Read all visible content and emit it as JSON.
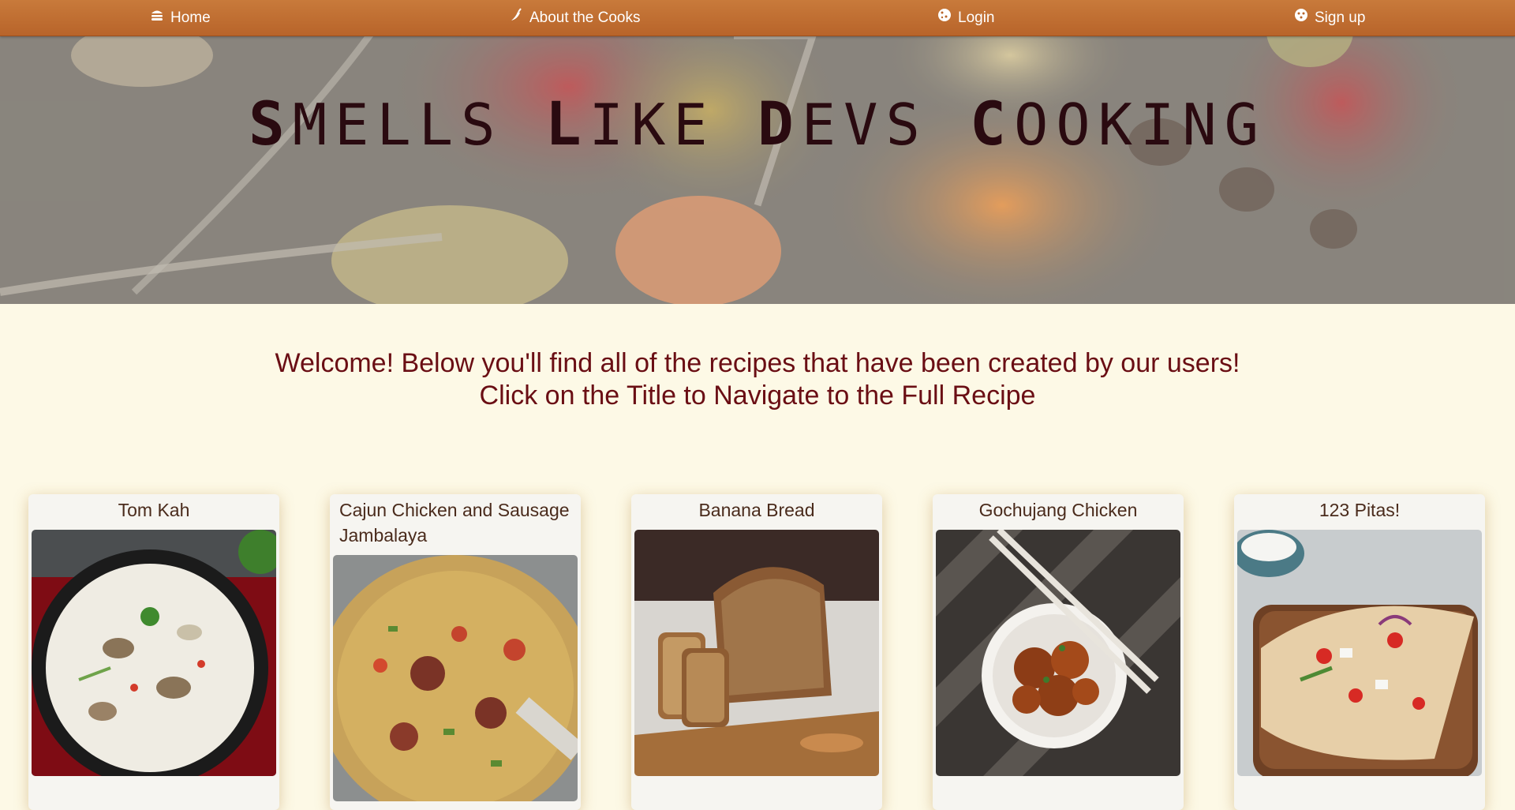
{
  "nav": {
    "home": "Home",
    "about": "About the Cooks",
    "login": "Login",
    "signup": "Sign up"
  },
  "hero": {
    "title_words": [
      {
        "cap": "S",
        "rest": "MELLS"
      },
      {
        "cap": "L",
        "rest": "IKE"
      },
      {
        "cap": "D",
        "rest": "EVS"
      },
      {
        "cap": "C",
        "rest": "OOKING"
      }
    ]
  },
  "welcome": {
    "line1": "Welcome! Below you'll find all of the recipes that have been created by our users!",
    "line2": "Click on the Title to Navigate to the Full Recipe"
  },
  "recipes": [
    {
      "title": "Tom Kah",
      "image": "tom-kah-soup-photo"
    },
    {
      "title": "Cajun Chicken and Sausage Jambalaya",
      "image": "jambalaya-pan-photo"
    },
    {
      "title": "Banana Bread",
      "image": "banana-bread-loaf-photo"
    },
    {
      "title": "Gochujang Chicken",
      "image": "gochujang-chicken-bowl-photo"
    },
    {
      "title": "123 Pitas!",
      "image": "stuffed-pitas-photo"
    }
  ],
  "colors": {
    "nav_bg": "#b8642a",
    "page_bg": "#fdf9e6",
    "welcome_text": "#6a0e14",
    "title_text": "#2a0a10"
  }
}
